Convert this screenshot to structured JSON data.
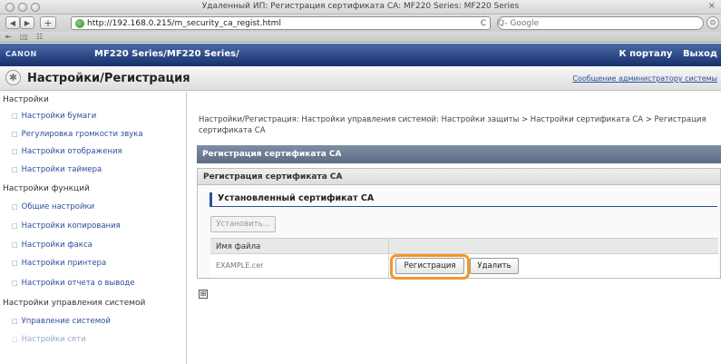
{
  "window": {
    "title": "Удаленный ИП: Регистрация сертификата CA: MF220 Series: MF220 Series",
    "close_glyph": "×"
  },
  "toolbar": {
    "back_label": "◀",
    "forward_label": "▶",
    "add_label": "+",
    "url": "http://192.168.0.215/m_security_ca_regist.html",
    "reload_label": "C",
    "search_placeholder": "Q- Google",
    "right_label": "⊙"
  },
  "bookmarks": {
    "items": [
      "⇤",
      "▯▯",
      "☷"
    ]
  },
  "header": {
    "brand": "CANON",
    "model": "MF220 Series/MF220 Series/",
    "portal_link": "К порталу",
    "logout_link": "Выход"
  },
  "page": {
    "title": "Настройки/Регистрация",
    "title_icon": "✱",
    "admin_message": "Сообщение администратору системы"
  },
  "sidebar": {
    "sections": [
      {
        "label": "Настройки",
        "items": [
          "Настройки бумаги",
          "Регулировка громкости звука",
          "Настройки отображения",
          "Настройки таймера"
        ]
      },
      {
        "label": "Настройки функций",
        "items": [
          "Общие настройки",
          "Настройки копирования",
          "Настройки факса",
          "Настройки принтера",
          "Настройки отчета о выводе"
        ]
      },
      {
        "label": "Настройки управления системой",
        "items": [
          "Управление системой",
          "Настройки сети"
        ]
      }
    ],
    "bullet": "□"
  },
  "main": {
    "breadcrumb": "Настройки/Регистрация: Настройки управления системой: Настройки защиты > Настройки сертификата CA > Регистрация сертификата CA",
    "section_title": "Регистрация сертификата CA",
    "panel_title": "Регистрация сертификата CA",
    "subsection_title": "Установленный сертификат CA",
    "install_button": "Установить...",
    "table": {
      "file_name_header": "Имя файла",
      "row_file_name": "EXAMPLE.cer",
      "register_button": "Регистрация",
      "delete_button": "Удалить"
    },
    "expand_icon": "⊞"
  },
  "colors": {
    "header_band": "#17306b",
    "section_bar": "#5d6c84",
    "link": "#2d4d9c",
    "highlight": "#f0982a"
  }
}
